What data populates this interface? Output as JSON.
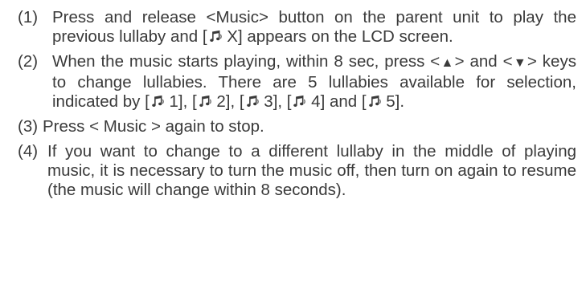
{
  "steps": [
    {
      "number": "(1)",
      "parts": {
        "a": "Press and release <Music> button on the parent unit to play the previous lullaby and [",
        "b": " X] appears on the LCD screen."
      }
    },
    {
      "number": "(2)",
      "parts": {
        "a": "When the music starts playing, within 8 sec, press <",
        "up": "▲",
        "b": "> and <",
        "down": "▼",
        "c": "> keys to change lullabies. There are 5 lullabies available for selection, indicated by [",
        "d": " 1], [",
        "e": " 2], [",
        "f": " 3], [",
        "g": " 4] and [",
        "h": " 5]."
      }
    },
    {
      "number": "(3)",
      "parts": {
        "a": "Press < Music > again to stop."
      }
    },
    {
      "number": "(4)",
      "parts": {
        "a": " If you want to change to a different lullaby in the middle of playing music, it is necessary to turn the music off, then turn on again to resume (the music will change within 8 seconds)."
      }
    }
  ],
  "icons": {
    "music_note": "music-note-icon"
  },
  "colors": {
    "text": "#3a3a3a"
  }
}
